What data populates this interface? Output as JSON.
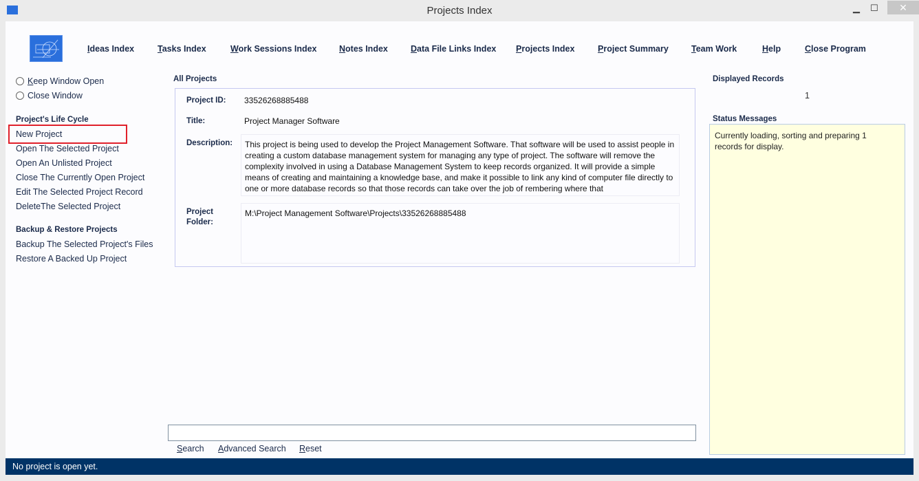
{
  "window": {
    "title": "Projects Index",
    "minimize": "▁",
    "maximize": "☐",
    "close": "✕"
  },
  "nav": [
    "Ideas Index",
    "Tasks Index",
    "Work Sessions Index",
    "Notes Index",
    "Data File Links Index",
    "Projects Index",
    "Project Summary",
    "Team Work",
    "Help",
    "Close Program"
  ],
  "sidebar": {
    "radios": [
      "Keep Window Open",
      "Close Window"
    ],
    "lifecycle_title": "Project's Life Cycle",
    "lifecycle": [
      "New Project",
      "Open The Selected Project",
      "Open An Unlisted Project",
      "Close The Currently Open Project",
      "Edit The Selected Project Record",
      "DeleteThe Selected Project"
    ],
    "backup_title": "Backup & Restore Projects",
    "backup": [
      "Backup The Selected Project's Files",
      "Restore A Backed Up Project"
    ]
  },
  "main": {
    "group_title": "All Projects",
    "labels": {
      "id": "Project ID:",
      "title": "Title:",
      "description": "Description:",
      "folder1": "Project",
      "folder2": "Folder:"
    },
    "record": {
      "id": "33526268885488",
      "title": "Project Manager Software",
      "description": "This project is being used to develop the Project Management Software. That software will be used to assist people in creating a custom database management system for managing any type of project. The software will remove the complexity involved in using a Database Management System to keep records organized. It will provide a simple means of creating and maintaining a knowledge base, and make it possible to link any kind of computer file directly to one or more database records so that those records can take over the job of rembering where that",
      "folder": "M:\\Project Management Software\\Projects\\33526268885488"
    },
    "search": {
      "value": "",
      "buttons": [
        "Search",
        "Advanced Search",
        "Reset"
      ]
    }
  },
  "right": {
    "displayed_title": "Displayed Records",
    "displayed_count": "1",
    "status_title": "Status Messages",
    "status_text": "Currently loading, sorting and preparing 1 records for display."
  },
  "statusbar": "No project is open yet.",
  "colors": {
    "accent": "#003366",
    "highlight": "#e0202a",
    "status_bg": "#ffffe0"
  }
}
